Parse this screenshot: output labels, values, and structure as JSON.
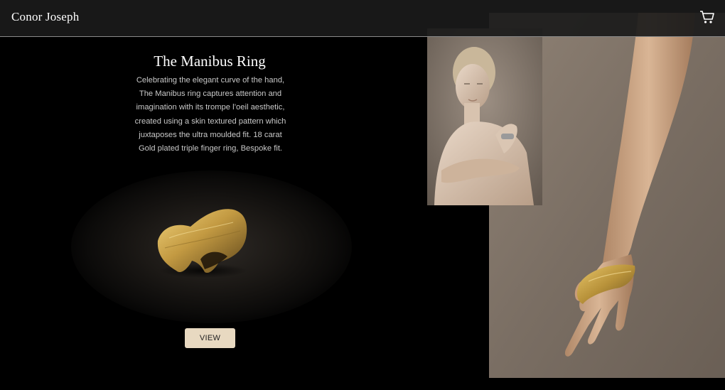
{
  "header": {
    "brand": "Conor Joseph",
    "cart_icon": "cart-icon"
  },
  "product": {
    "title": "The Manibus Ring",
    "description": "Celebrating the elegant curve of the hand, The Manibus ring captures attention and imagination with its trompe l’oeil aesthetic, created using a skin textured pattern which juxtaposes the ultra moulded fit. 18 carat Gold plated triple finger ring, Bespoke fit.",
    "view_label": "VIEW",
    "image": "gold-ring-product-photo"
  },
  "gallery": {
    "portrait_image": "model-portrait-photo",
    "hand_image": "hand-wearing-ring-photo"
  },
  "colors": {
    "background": "#000000",
    "header_bg": "#1a1a1a",
    "button_bg": "#e8d9c1",
    "text_primary": "#ffffff",
    "text_secondary": "#c9c9c9",
    "gold": "#b8923a"
  }
}
